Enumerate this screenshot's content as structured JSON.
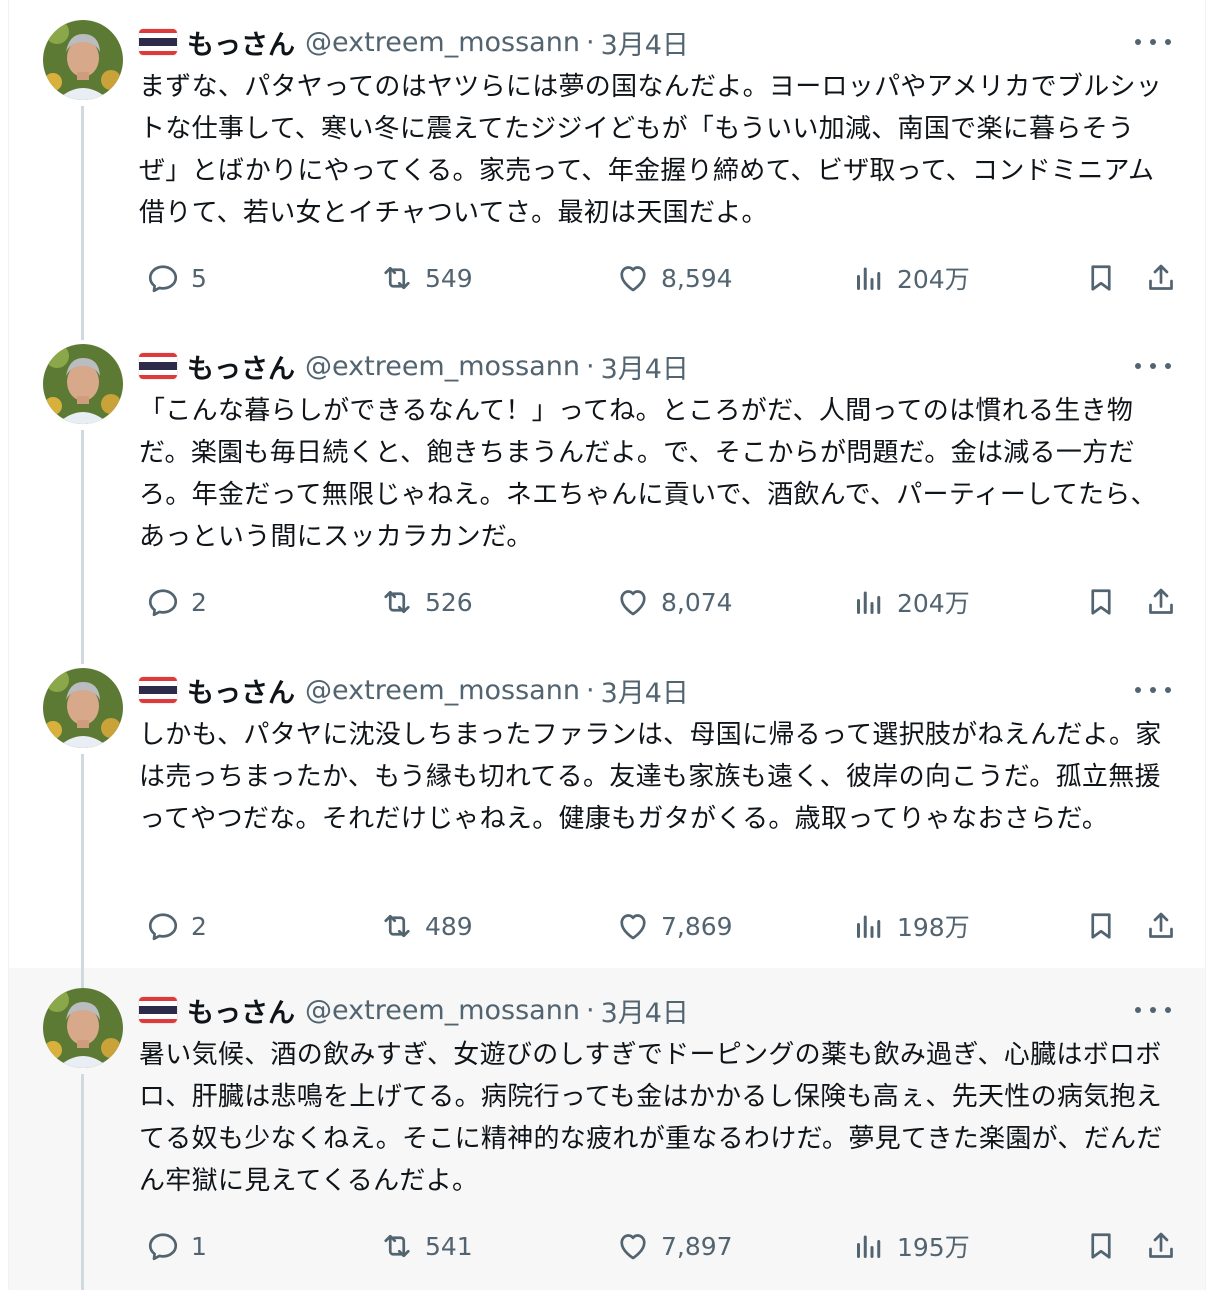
{
  "author": {
    "name": "もっさん",
    "handle": "@extreem_mossann",
    "separator": "·",
    "flag_icon": "thailand-flag-icon"
  },
  "tweets": [
    {
      "date": "3月4日",
      "text": "まずな、パタヤってのはヤツらには夢の国なんだよ。ヨーロッパやアメリカでブルシットな仕事して、寒い冬に震えてたジジイどもが「もういい加減、南国で楽に暮らそうぜ」とばかりにやってくる。家売って、年金握り締めて、ビザ取って、コンドミニアム借りて、若い女とイチャついてさ。最初は天国だよ。",
      "replies": "5",
      "retweets": "549",
      "likes": "8,594",
      "views": "204万"
    },
    {
      "date": "3月4日",
      "text": "「こんな暮らしができるなんて！」ってね。ところがだ、人間ってのは慣れる生き物だ。楽園も毎日続くと、飽きちまうんだよ。で、そこからが問題だ。金は減る一方だろ。年金だって無限じゃねえ。ネエちゃんに貢いで、酒飲んで、パーティーしてたら、あっという間にスッカラカンだ。",
      "replies": "2",
      "retweets": "526",
      "likes": "8,074",
      "views": "204万"
    },
    {
      "date": "3月4日",
      "text": "しかも、パタヤに沈没しちまったファランは、母国に帰るって選択肢がねえんだよ。家は売っちまったか、もう縁も切れてる。友達も家族も遠く、彼岸の向こうだ。孤立無援ってやつだな。それだけじゃねえ。健康もガタがくる。歳取ってりゃなおさらだ。",
      "replies": "2",
      "retweets": "489",
      "likes": "7,869",
      "views": "198万"
    },
    {
      "date": "3月4日",
      "text": "暑い気候、酒の飲みすぎ、女遊びのしすぎでドーピングの薬も飲み過ぎ、心臓はボロボロ、肝臓は悲鳴を上げてる。病院行っても金はかかるし保険も高ぇ、先天性の病気抱えてる奴も少なくねえ。そこに精神的な疲れが重なるわけだ。夢見てきた楽園が、だんだん牢獄に見えてくるんだよ。",
      "replies": "1",
      "retweets": "541",
      "likes": "7,897",
      "views": "195万"
    }
  ],
  "colors": {
    "text": "#0f1419",
    "secondary": "#536471",
    "thread_line": "#cfd9de",
    "highlight_bg": "#f7f7f7"
  }
}
